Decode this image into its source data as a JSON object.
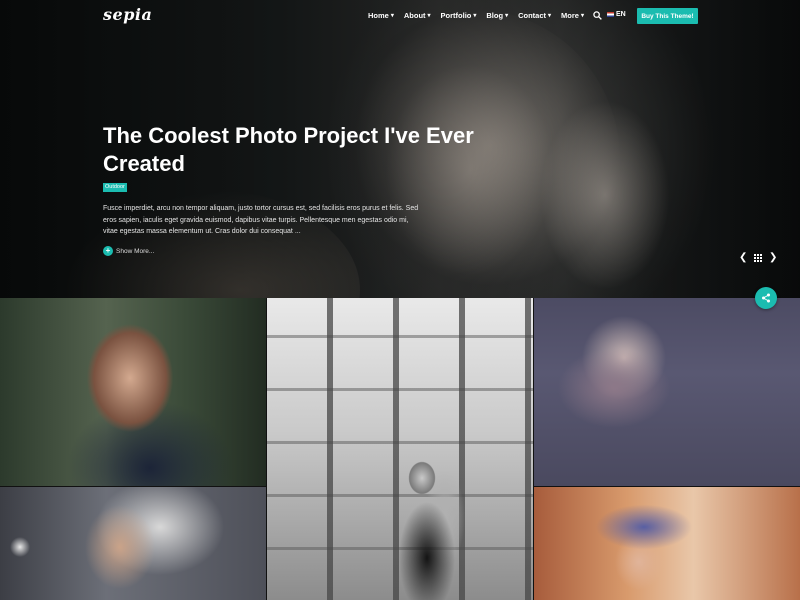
{
  "brand": {
    "logo": "sepia",
    "accent": "#1bbcb0"
  },
  "nav": {
    "items": [
      {
        "label": "Home",
        "icon": "chevron-down-icon"
      },
      {
        "label": "About",
        "icon": "chevron-down-icon"
      },
      {
        "label": "Portfolio",
        "icon": "chevron-down-icon"
      },
      {
        "label": "Blog",
        "icon": "chevron-down-icon"
      },
      {
        "label": "Contact",
        "icon": "chevron-down-icon"
      },
      {
        "label": "More",
        "icon": "chevron-down-icon"
      }
    ],
    "search_icon": "search-icon",
    "language": "EN",
    "cta": "Buy This Theme!"
  },
  "hero": {
    "title": "The Coolest Photo Project I've Ever Created",
    "tag": "Outdoor",
    "excerpt": "Fusce imperdiet, arcu non tempor aliquam, justo tortor cursus est, sed facilisis eros purus et felis. Sed eros sapien, iaculis eget gravida euismod, dapibus vitae turpis. Pellentesque men egestas odio mi, vitae egestas massa elementum ut. Cras dolor dui consequat ...",
    "show_more": "Show More...",
    "prev_icon": "chevron-left-icon",
    "grid_icon": "grid-icon",
    "next_icon": "chevron-right-icon"
  },
  "share_icon": "share-icon",
  "gallery": {
    "tiles": [
      {
        "subject": "woman-wet-hair-portrait"
      },
      {
        "subject": "woman-black-white-fence"
      },
      {
        "subject": "woman-armchair-vintage"
      },
      {
        "subject": "woman-tattooed-portrait"
      },
      {
        "subject": "woman-blue-hat"
      }
    ]
  }
}
